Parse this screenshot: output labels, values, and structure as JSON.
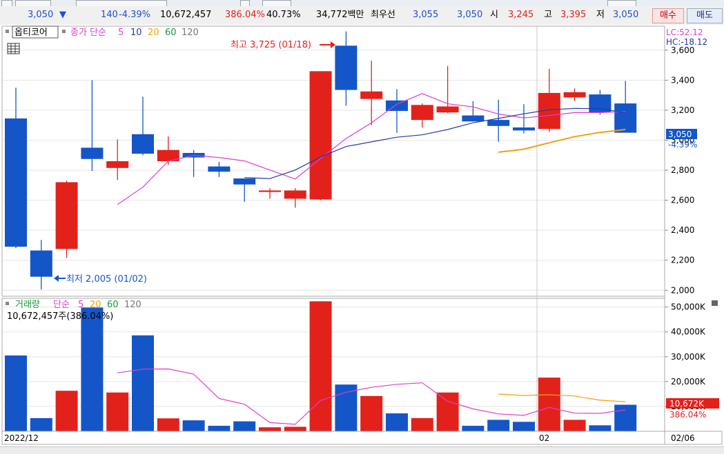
{
  "infobar": {
    "price": "3,050",
    "change_arrow": "▼",
    "change": "140",
    "change_pct": "-4.39%",
    "volume": "10,672,457",
    "volume_ratio": "386.04%",
    "turnover": "40.73%",
    "amount": "34,772백만",
    "best_bid_label": "최우선",
    "best_ask": "3,055",
    "best_bid": "3,050",
    "open_label": "시",
    "open": "3,245",
    "high_label": "고",
    "high": "3,395",
    "low_label": "저",
    "low": "3,050",
    "buy_button": "매수",
    "sell_button": "매도"
  },
  "price_panel": {
    "option_label": "옵티코어",
    "ma_title": "종가 단순",
    "ma_periods": [
      "5",
      "10",
      "20",
      "60",
      "120"
    ],
    "lc": "LC:52.12",
    "hc": "HC:-18.12",
    "current_price_tag": "3,050",
    "current_change_tag": "-4.39%",
    "high_annotation": "최고 3,725 (01/18)",
    "low_annotation": "최저 2,005 (01/02)"
  },
  "volume_panel": {
    "title": "거래량",
    "ma_title": "단순",
    "ma_periods": [
      "5",
      "20",
      "60",
      "120"
    ],
    "summary": "10,672,457주(386.04%)",
    "current_volume_tag": "10,672K",
    "current_ratio_tag": "386.04%"
  },
  "x_axis": {
    "labels": [
      "2022/12",
      "02",
      "02/06"
    ]
  },
  "colors": {
    "up": "#e3211b",
    "down": "#1456c8",
    "ma5": "#e03cc8",
    "ma10": "#1f3aa8",
    "ma20": "#f0a010",
    "ma60": "#169a3a",
    "ma120": "#777777"
  },
  "chart_data": [
    {
      "type": "candlestick",
      "title": "옵티코어",
      "ylim": [
        1960,
        3760
      ],
      "yticks": [
        2000,
        2200,
        2400,
        2600,
        2800,
        3000,
        3200,
        3400,
        3600
      ],
      "ytick_labels": [
        "2,000",
        "2,200",
        "2,400",
        "2,600",
        "2,800",
        "3,000",
        "3,200",
        "3,400",
        "3,600"
      ],
      "candles": [
        {
          "o": 3145,
          "h": 3350,
          "l": 2280,
          "c": 2290
        },
        {
          "o": 2265,
          "h": 2335,
          "l": 2005,
          "c": 2090
        },
        {
          "o": 2275,
          "h": 2730,
          "l": 2215,
          "c": 2720
        },
        {
          "o": 2950,
          "h": 3400,
          "l": 2795,
          "c": 2875
        },
        {
          "o": 2815,
          "h": 3005,
          "l": 2735,
          "c": 2860
        },
        {
          "o": 3040,
          "h": 3290,
          "l": 2900,
          "c": 2910
        },
        {
          "o": 2860,
          "h": 3025,
          "l": 2835,
          "c": 2935
        },
        {
          "o": 2915,
          "h": 2935,
          "l": 2755,
          "c": 2885
        },
        {
          "o": 2825,
          "h": 2855,
          "l": 2755,
          "c": 2790
        },
        {
          "o": 2745,
          "h": 2745,
          "l": 2590,
          "c": 2705
        },
        {
          "o": 2655,
          "h": 2680,
          "l": 2610,
          "c": 2665
        },
        {
          "o": 2610,
          "h": 2680,
          "l": 2550,
          "c": 2665
        },
        {
          "o": 2605,
          "h": 3460,
          "l": 2600,
          "c": 3460
        },
        {
          "o": 3630,
          "h": 3725,
          "l": 3230,
          "c": 3335
        },
        {
          "o": 3275,
          "h": 3530,
          "l": 3100,
          "c": 3325
        },
        {
          "o": 3265,
          "h": 3340,
          "l": 3050,
          "c": 3195
        },
        {
          "o": 3135,
          "h": 3245,
          "l": 3085,
          "c": 3235
        },
        {
          "o": 3185,
          "h": 3495,
          "l": 3180,
          "c": 3225
        },
        {
          "o": 3165,
          "h": 3260,
          "l": 3125,
          "c": 3125
        },
        {
          "o": 3135,
          "h": 3270,
          "l": 2990,
          "c": 3095
        },
        {
          "o": 3085,
          "h": 3240,
          "l": 3045,
          "c": 3065
        },
        {
          "o": 3075,
          "h": 3475,
          "l": 3055,
          "c": 3315
        },
        {
          "o": 3285,
          "h": 3345,
          "l": 3260,
          "c": 3320
        },
        {
          "o": 3305,
          "h": 3335,
          "l": 3170,
          "c": 3185
        },
        {
          "o": 3245,
          "h": 3395,
          "l": 3050,
          "c": 3050
        }
      ],
      "series": [
        {
          "name": "5",
          "values": [
            null,
            null,
            null,
            null,
            2571,
            2687,
            2860,
            2900,
            2885,
            2862,
            2801,
            2741,
            2879,
            3011,
            3116,
            3240,
            3311,
            3243,
            3222,
            3175,
            3149,
            3165,
            3184,
            3184,
            3190
          ]
        },
        {
          "name": "10",
          "values": [
            null,
            null,
            null,
            null,
            null,
            null,
            null,
            null,
            null,
            2751,
            2744,
            2801,
            2889,
            2958,
            2989,
            3020,
            3036,
            3071,
            3116,
            3145,
            3176,
            3203,
            3212,
            3210,
            3183
          ]
        },
        {
          "name": "20",
          "values": [
            null,
            null,
            null,
            null,
            null,
            null,
            null,
            null,
            null,
            null,
            null,
            null,
            null,
            null,
            null,
            null,
            null,
            null,
            null,
            2920,
            2940,
            2983,
            3024,
            3052,
            3071
          ]
        }
      ]
    },
    {
      "type": "bar",
      "title": "거래량",
      "ylim": [
        0,
        56000
      ],
      "yticks": [
        10000,
        20000,
        30000,
        40000,
        50000
      ],
      "ytick_labels": [
        "10,000K",
        "20,000K",
        "30,000K",
        "40,000K",
        "50,000K"
      ],
      "values": [
        30500,
        5300,
        16300,
        49800,
        15600,
        38600,
        5200,
        4400,
        2200,
        4000,
        1600,
        1800,
        52300,
        18800,
        14200,
        7200,
        5300,
        15600,
        2200,
        4600,
        3800,
        21600,
        4600,
        2400,
        10672
      ],
      "series": [
        {
          "name": "5",
          "values": [
            null,
            null,
            null,
            null,
            23500,
            25000,
            25100,
            23000,
            13200,
            10900,
            3500,
            2800,
            12400,
            15700,
            17700,
            18900,
            19500,
            12100,
            9000,
            7000,
            6400,
            9600,
            7300,
            7200,
            8600
          ]
        },
        {
          "name": "20",
          "values": [
            null,
            null,
            null,
            null,
            null,
            null,
            null,
            null,
            null,
            null,
            null,
            null,
            null,
            null,
            null,
            null,
            null,
            null,
            null,
            15000,
            14400,
            14700,
            14200,
            12500,
            11900
          ]
        }
      ]
    }
  ]
}
